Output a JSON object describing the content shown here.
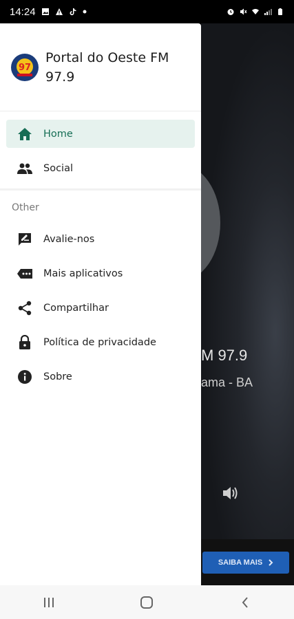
{
  "status_bar": {
    "time": "14:24"
  },
  "drawer": {
    "title": "Portal do Oeste FM 97.9",
    "logo_text": "97",
    "nav": [
      {
        "label": "Home",
        "icon": "home-icon",
        "active": true
      },
      {
        "label": "Social",
        "icon": "people-icon",
        "active": false
      }
    ],
    "other_section": "Other",
    "other": [
      {
        "label": "Avalie-nos",
        "icon": "rate-review-icon"
      },
      {
        "label": "Mais aplicativos",
        "icon": "more-apps-icon"
      },
      {
        "label": "Compartilhar",
        "icon": "share-icon"
      },
      {
        "label": "Política de privacidade",
        "icon": "lock-icon"
      },
      {
        "label": "Sobre",
        "icon": "info-icon"
      }
    ]
  },
  "background": {
    "station_partial": "M 97.9",
    "location_partial": "ama - BA",
    "cta_label": "SAIBA MAIS"
  },
  "colors": {
    "accent": "#166e55",
    "active_bg": "#e6f2ee",
    "cta": "#1f5fb5"
  }
}
